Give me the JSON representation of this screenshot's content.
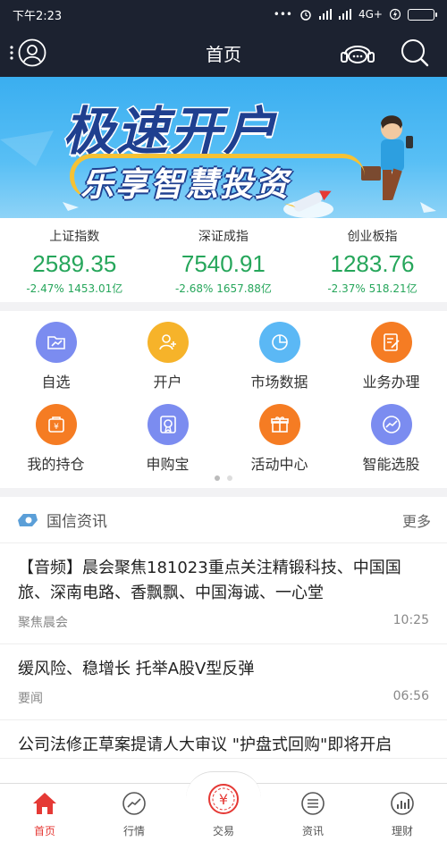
{
  "status_bar": {
    "time": "下午2:23",
    "icons": [
      "more-icon",
      "alarm-icon",
      "signal-icon",
      "signal-icon",
      "network-4g-icon",
      "flash-icon",
      "battery-icon"
    ],
    "network": "4G+"
  },
  "nav": {
    "title": "首页",
    "left_icon": "user-icon",
    "right_icons": [
      "customer-service-icon",
      "search-icon"
    ]
  },
  "banner": {
    "headline": "极速开户",
    "subline": "乐享智慧投资"
  },
  "indexes": [
    {
      "name": "上证指数",
      "value": "2589.35",
      "change": "-2.47%",
      "volume": "1453.01亿"
    },
    {
      "name": "深证成指",
      "value": "7540.91",
      "change": "-2.68%",
      "volume": "1657.88亿"
    },
    {
      "name": "创业板指",
      "value": "1283.76",
      "change": "-2.37%",
      "volume": "518.21亿"
    }
  ],
  "grid": [
    {
      "label": "自选",
      "icon": "chart-icon",
      "color": "#7b8cf0"
    },
    {
      "label": "开户",
      "icon": "add-user-icon",
      "color": "#f6b32a"
    },
    {
      "label": "市场数据",
      "icon": "pie-chart-icon",
      "color": "#5bb8f5"
    },
    {
      "label": "业务办理",
      "icon": "form-icon",
      "color": "#f57c23"
    },
    {
      "label": "我的持仓",
      "icon": "wallet-icon",
      "color": "#f57c23"
    },
    {
      "label": "申购宝",
      "icon": "certificate-icon",
      "color": "#7b8cf0"
    },
    {
      "label": "活动中心",
      "icon": "gift-icon",
      "color": "#f57c23"
    },
    {
      "label": "智能选股",
      "icon": "trend-icon",
      "color": "#7b8cf0"
    }
  ],
  "news": {
    "header": "国信资讯",
    "more": "更多",
    "items": [
      {
        "headline": "【音频】晨会聚焦181023重点关注精锻科技、中国国旅、深南电路、香飘飘、中国海诚、一心堂",
        "source": "聚焦晨会",
        "time": "10:25"
      },
      {
        "headline": "缓风险、稳增长 托举A股V型反弹",
        "source": "要闻",
        "time": "06:56"
      },
      {
        "headline": "公司法修正草案提请人大审议 \"护盘式回购\"即将开启",
        "source": "",
        "time": ""
      }
    ]
  },
  "tabs": [
    {
      "label": "首页",
      "icon": "home-icon"
    },
    {
      "label": "行情",
      "icon": "trend-icon"
    },
    {
      "label": "交易",
      "icon": "yuan-icon"
    },
    {
      "label": "资讯",
      "icon": "news-icon"
    },
    {
      "label": "理财",
      "icon": "bar-chart-icon"
    }
  ],
  "colors": {
    "nav_bg": "#1c2230",
    "index_green": "#26a65b",
    "accent_red": "#e53935",
    "banner_blue": "#3aaef0"
  }
}
